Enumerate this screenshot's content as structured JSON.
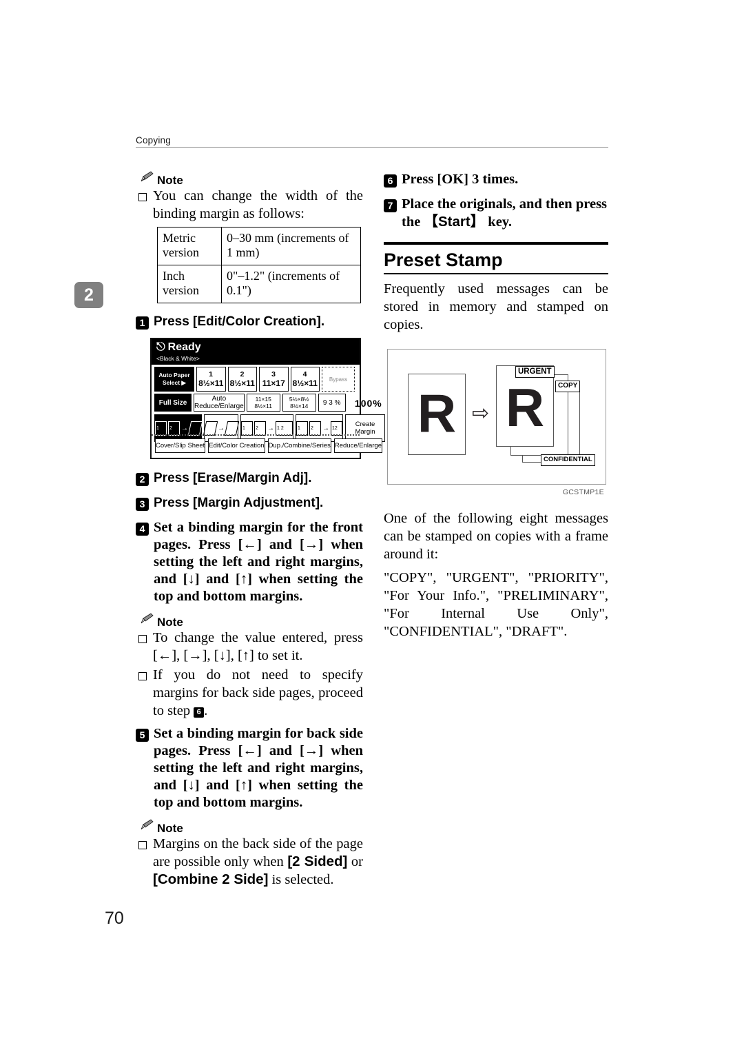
{
  "header": {
    "running_head": "Copying"
  },
  "chapter_tab": {
    "number": "2"
  },
  "page_number": "70",
  "left_column": {
    "note1": {
      "label": "Note",
      "bullet": "You can change the width of the binding margin as follows:"
    },
    "margin_table": {
      "rows": [
        {
          "label": "Metric version",
          "value": "0–30 mm (increments of 1 mm)"
        },
        {
          "label": "Inch version",
          "value": "0\"–1.2\" (increments of 0.1\")"
        }
      ]
    },
    "step1": {
      "num": "1",
      "text": "Press [Edit/Color Creation]."
    },
    "step2": {
      "num": "2",
      "text": "Press [Erase/Margin Adj]."
    },
    "step3": {
      "num": "3",
      "text": "Press [Margin Adjustment]."
    },
    "step4": {
      "num": "4",
      "text": "Set a binding margin for the front pages. Press [←] and [→] when setting the left and right margins, and [↓] and [↑] when setting the top and bottom margins."
    },
    "note2": {
      "label": "Note",
      "bullet1": "To change the value entered, press [←], [→], [↓], [↑] to set it.",
      "bullet2_pre": "If you do not need to specify margins for back side pages, proceed to step ",
      "bullet2_step": "6",
      "bullet2_post": "."
    },
    "step5": {
      "num": "5",
      "text": "Set a binding margin for back side pages. Press [←] and [→] when setting the left and right margins, and [↓] and [↑] when setting the top and bottom margins."
    },
    "note3": {
      "label": "Note",
      "bullet_pre": "Margins on the back side of the page are possible only when ",
      "key1": "[2 Sided]",
      "mid": " or ",
      "key2": "[Combine 2 Side]",
      "bullet_post": " is selected."
    }
  },
  "lcd": {
    "status": "Ready",
    "color_mode": "<Black & White>",
    "power_icon": "power-icon",
    "paper_select": "Auto Paper Select ▶",
    "trays": [
      {
        "num": "1",
        "size": "8½×11"
      },
      {
        "num": "2",
        "size": "8½×11"
      },
      {
        "num": "3",
        "size": "11×17"
      },
      {
        "num": "4",
        "size": "8½×11"
      }
    ],
    "bypass": "Bypass",
    "full_size": "Full Size",
    "auto_reduce": "Auto Reduce/Enlarge",
    "ratio_pair_1_top": "11×15",
    "ratio_pair_1_bot": "8½×11",
    "ratio_pair_2_top": "5½×8½",
    "ratio_pair_2_bot": "8½×14",
    "ratio_93": "9 3 %",
    "zoom_value": "100%",
    "create_margin_l1": "Create",
    "create_margin_l2": "Margin",
    "function_keys": [
      "Cover/Slip Sheet",
      "Edit/Color Creation",
      "Dup./Combine/Series",
      "Reduce/Enlarge"
    ]
  },
  "right_column": {
    "step6": {
      "num": "6",
      "text": "Press [OK] 3 times."
    },
    "step7": {
      "num": "7",
      "pre": "Place the originals, and then press the ",
      "key": "【Start】",
      "post": " key."
    },
    "section_title": "Preset Stamp",
    "intro": "Frequently used messages can be stored in memory and stamped on copies.",
    "figure": {
      "original_letter": "R",
      "output_letter": "R",
      "arrow": "⇨",
      "stamps": {
        "urgent": "URGENT",
        "copy": "COPY",
        "confidential": "CONFIDENTIAL"
      },
      "code": "GCSTMP1E"
    },
    "para1": "One of the following eight messages can be stamped on copies with a frame around it:",
    "para2": "\"COPY\", \"URGENT\", \"PRIORITY\", \"For Your Info.\", \"PRELIMINARY\", \"For Internal Use Only\", \"CONFIDENTIAL\", \"DRAFT\"."
  }
}
